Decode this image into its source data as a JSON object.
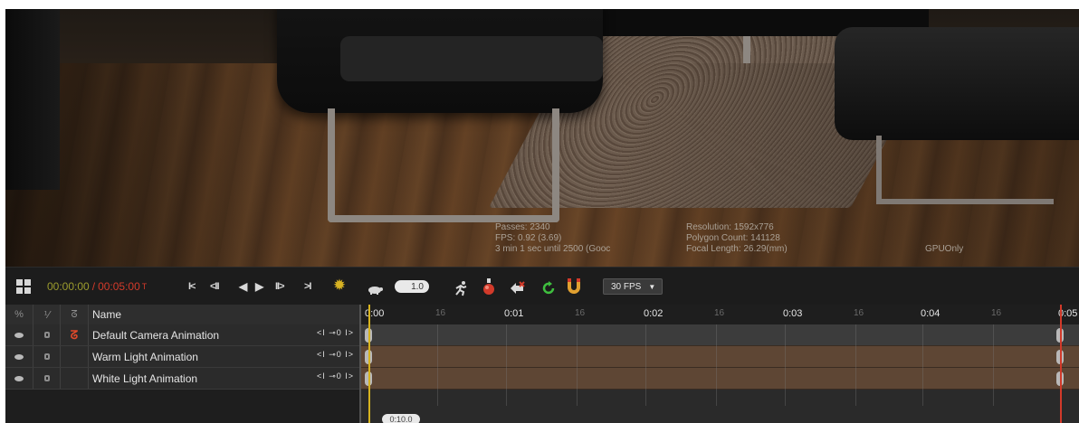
{
  "viewport": {
    "stats_left": [
      "Passes: 2340",
      "FPS: 0.92 (3.69)",
      "3 min 1 sec until 2500 (Gooc"
    ],
    "stats_right": [
      "Resolution: 1592x776",
      "Polygon Count: 141128",
      "Focal Length: 26.29(mm)"
    ],
    "mode": "GPUOnly"
  },
  "toolbar": {
    "time_current": "00:00:00",
    "time_separator": "/",
    "time_end": "00:05:00",
    "time_suffix": "T",
    "btn_first": "I<",
    "btn_prev_key": "<II",
    "btn_play_back": "◀",
    "btn_play": "▶",
    "btn_next_key": "II>",
    "btn_last": ">I",
    "speed_value": "1.0",
    "fps_value": "30 FPS"
  },
  "track_header": {
    "name_label": "Name"
  },
  "tracks": [
    {
      "name": "Default Camera Animation"
    },
    {
      "name": "Warm Light Animation"
    },
    {
      "name": "White Light Animation"
    }
  ],
  "timeline": {
    "major_ticks": [
      "0:00",
      "0:01",
      "0:02",
      "0:03",
      "0:04",
      "0:05"
    ],
    "minor_ticks": [
      "16",
      "16",
      "16",
      "16",
      "16"
    ],
    "zoom_value": "0:10.0"
  }
}
